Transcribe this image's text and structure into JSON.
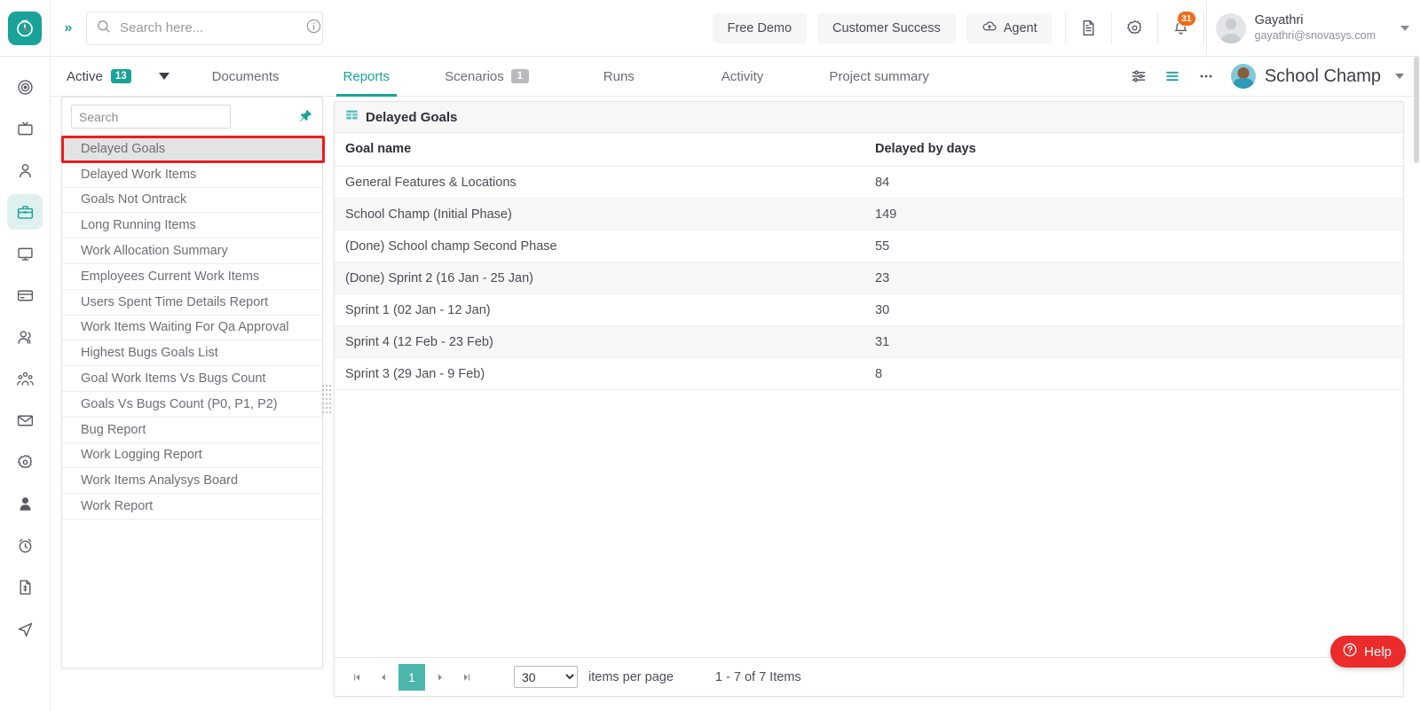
{
  "header": {
    "logo_icon": "clock-logo-icon",
    "expand_icon": "chevrons-right-icon",
    "search": {
      "placeholder": "Search here...",
      "value": "",
      "icon": "search-icon",
      "info_icon": "info-circle-icon"
    },
    "pills": [
      {
        "label": "Free Demo",
        "icon": null
      },
      {
        "label": "Customer Success",
        "icon": null
      },
      {
        "label": "Agent",
        "icon": "cloud-upload-icon"
      }
    ],
    "icons": [
      {
        "name": "document-icon"
      },
      {
        "name": "gear-icon"
      },
      {
        "name": "bell-icon",
        "badge": "31"
      }
    ],
    "user": {
      "name": "Gayathri",
      "email": "gayathri@snovasys.com",
      "avatar": "user-avatar",
      "caret": "chevron-down-icon"
    }
  },
  "rail": {
    "items": [
      {
        "name": "target-icon",
        "active": false
      },
      {
        "name": "tv-icon",
        "active": false
      },
      {
        "name": "person-icon",
        "active": false
      },
      {
        "name": "briefcase-icon",
        "active": true
      },
      {
        "name": "monitor-icon",
        "active": false
      },
      {
        "name": "card-icon",
        "active": false
      },
      {
        "name": "users-icon",
        "active": false
      },
      {
        "name": "group-icon",
        "active": false
      },
      {
        "name": "mail-icon",
        "active": false
      },
      {
        "name": "settings-gear-icon",
        "active": false
      },
      {
        "name": "user-filled-icon",
        "active": false
      },
      {
        "name": "alarm-clock-icon",
        "active": false
      },
      {
        "name": "invoice-icon",
        "active": false
      },
      {
        "name": "send-icon",
        "active": false
      }
    ]
  },
  "tabstrip": {
    "active_filter": {
      "label": "Active",
      "count": "13"
    },
    "tabs": [
      {
        "label": "Documents",
        "selected": false,
        "count": null
      },
      {
        "label": "Reports",
        "selected": true,
        "count": null
      },
      {
        "label": "Scenarios",
        "selected": false,
        "count": "1"
      },
      {
        "label": "Runs",
        "selected": false,
        "count": null
      },
      {
        "label": "Activity",
        "selected": false,
        "count": null
      },
      {
        "label": "Project summary",
        "selected": false,
        "count": null
      }
    ],
    "right_icons": [
      {
        "name": "filter-sliders-icon"
      },
      {
        "name": "list-view-icon"
      },
      {
        "name": "more-options-icon"
      }
    ],
    "project": {
      "name": "School Champ",
      "avatar": "project-avatar",
      "caret": "chevron-down-icon"
    }
  },
  "report_list": {
    "search_placeholder": "Search",
    "search_value": "",
    "pin_icon": "pin-icon",
    "selected": "Delayed Goals",
    "items": [
      "Delayed Goals",
      "Delayed Work Items",
      "Goals Not Ontrack",
      "Long Running Items",
      "Work Allocation Summary",
      "Employees Current Work Items",
      "Users Spent Time Details Report",
      "Work Items Waiting For Qa Approval",
      "Highest Bugs Goals List",
      "Goal Work Items Vs Bugs Count",
      "Goals Vs Bugs Count (P0, P1, P2)",
      "Bug Report",
      "Work Logging Report",
      "Work Items Analysys Board",
      "Work Report"
    ]
  },
  "panel": {
    "title": "Delayed Goals",
    "title_icon": "grid-table-icon",
    "columns": [
      "Goal name",
      "Delayed by days"
    ],
    "rows": [
      {
        "goal": "General Features & Locations",
        "days": "84"
      },
      {
        "goal": "School Champ (Initial Phase)",
        "days": "149"
      },
      {
        "goal": "(Done) School champ Second Phase",
        "days": "55"
      },
      {
        "goal": "(Done) Sprint 2 (16 Jan - 25 Jan)",
        "days": "23"
      },
      {
        "goal": "Sprint 1 (02 Jan - 12 Jan)",
        "days": "30"
      },
      {
        "goal": "Sprint 4 (12 Feb - 23 Feb)",
        "days": "31"
      },
      {
        "goal": "Sprint 3 (29 Jan - 9 Feb)",
        "days": "8"
      }
    ],
    "pagination": {
      "first_icon": "first-page-icon",
      "prev_icon": "prev-page-icon",
      "current_page": "1",
      "next_icon": "next-page-icon",
      "last_icon": "last-page-icon",
      "page_size": "30",
      "page_size_options": [
        "30"
      ],
      "items_per_page_label": "items per page",
      "range_label": "1 - 7 of 7 Items"
    }
  },
  "help": {
    "label": "Help",
    "icon": "question-circle-icon"
  },
  "colors": {
    "accent": "#19a398",
    "badge_orange": "#ef6c1a",
    "highlight_red": "#ee1c1c",
    "help_red": "#ec2b2b",
    "page_teal": "#4db6ac"
  }
}
